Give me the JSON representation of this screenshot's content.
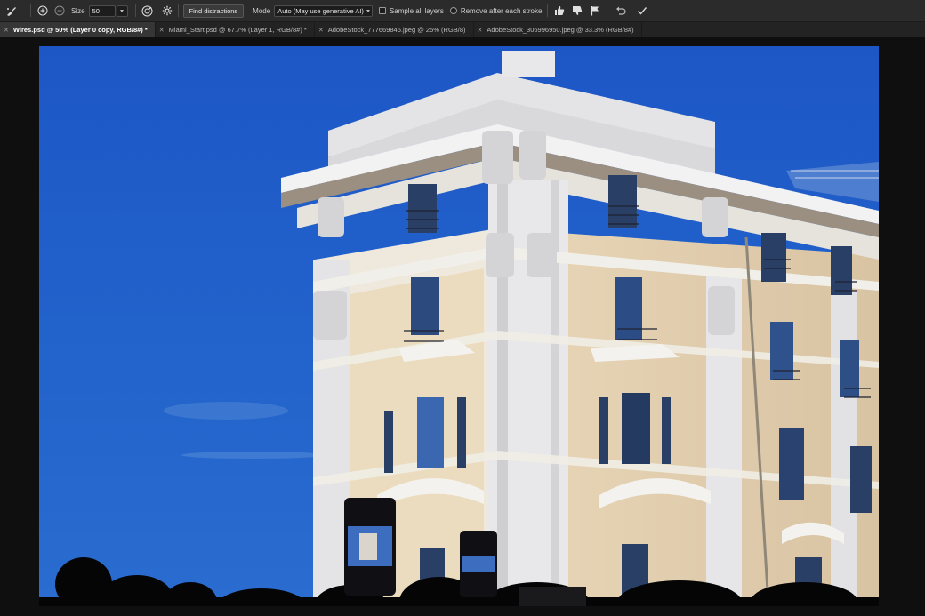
{
  "options_bar": {
    "tool_icon": "brush-icon",
    "add_icon": "plus-circle-icon",
    "subtract_icon": "minus-circle-icon",
    "size_label": "Size",
    "size_value": "50",
    "pressure_icon": "pressure-icon",
    "settings_icon": "gear-icon",
    "find_button": "Find distractions",
    "mode_label": "Mode",
    "mode_value": "Auto (May use generative AI)",
    "sample_label": "Sample all layers",
    "remove_label": "Remove after each stroke",
    "thumbs_up_icon": "thumbs-up-icon",
    "thumbs_down_icon": "thumbs-down-icon",
    "flag_icon": "flag-icon",
    "undo_icon": "undo-icon",
    "commit_icon": "checkmark-icon"
  },
  "tabs": [
    {
      "label": "Wires.psd @ 50% (Layer 0 copy, RGB/8#) *",
      "active": true
    },
    {
      "label": "Miami_Start.psd @ 67.7% (Layer 1, RGB/8#) *",
      "active": false
    },
    {
      "label": "AdobeStock_777669846.jpeg @ 25% (RGB/8)",
      "active": false
    },
    {
      "label": "AdobeStock_306996950.jpeg @ 33.3% (RGB/8#)",
      "active": false
    }
  ],
  "colors": {
    "sky": "#1f5bc9",
    "facade": "#ead9bd",
    "stone": "#dcdcde",
    "window": "#2a3f66"
  }
}
